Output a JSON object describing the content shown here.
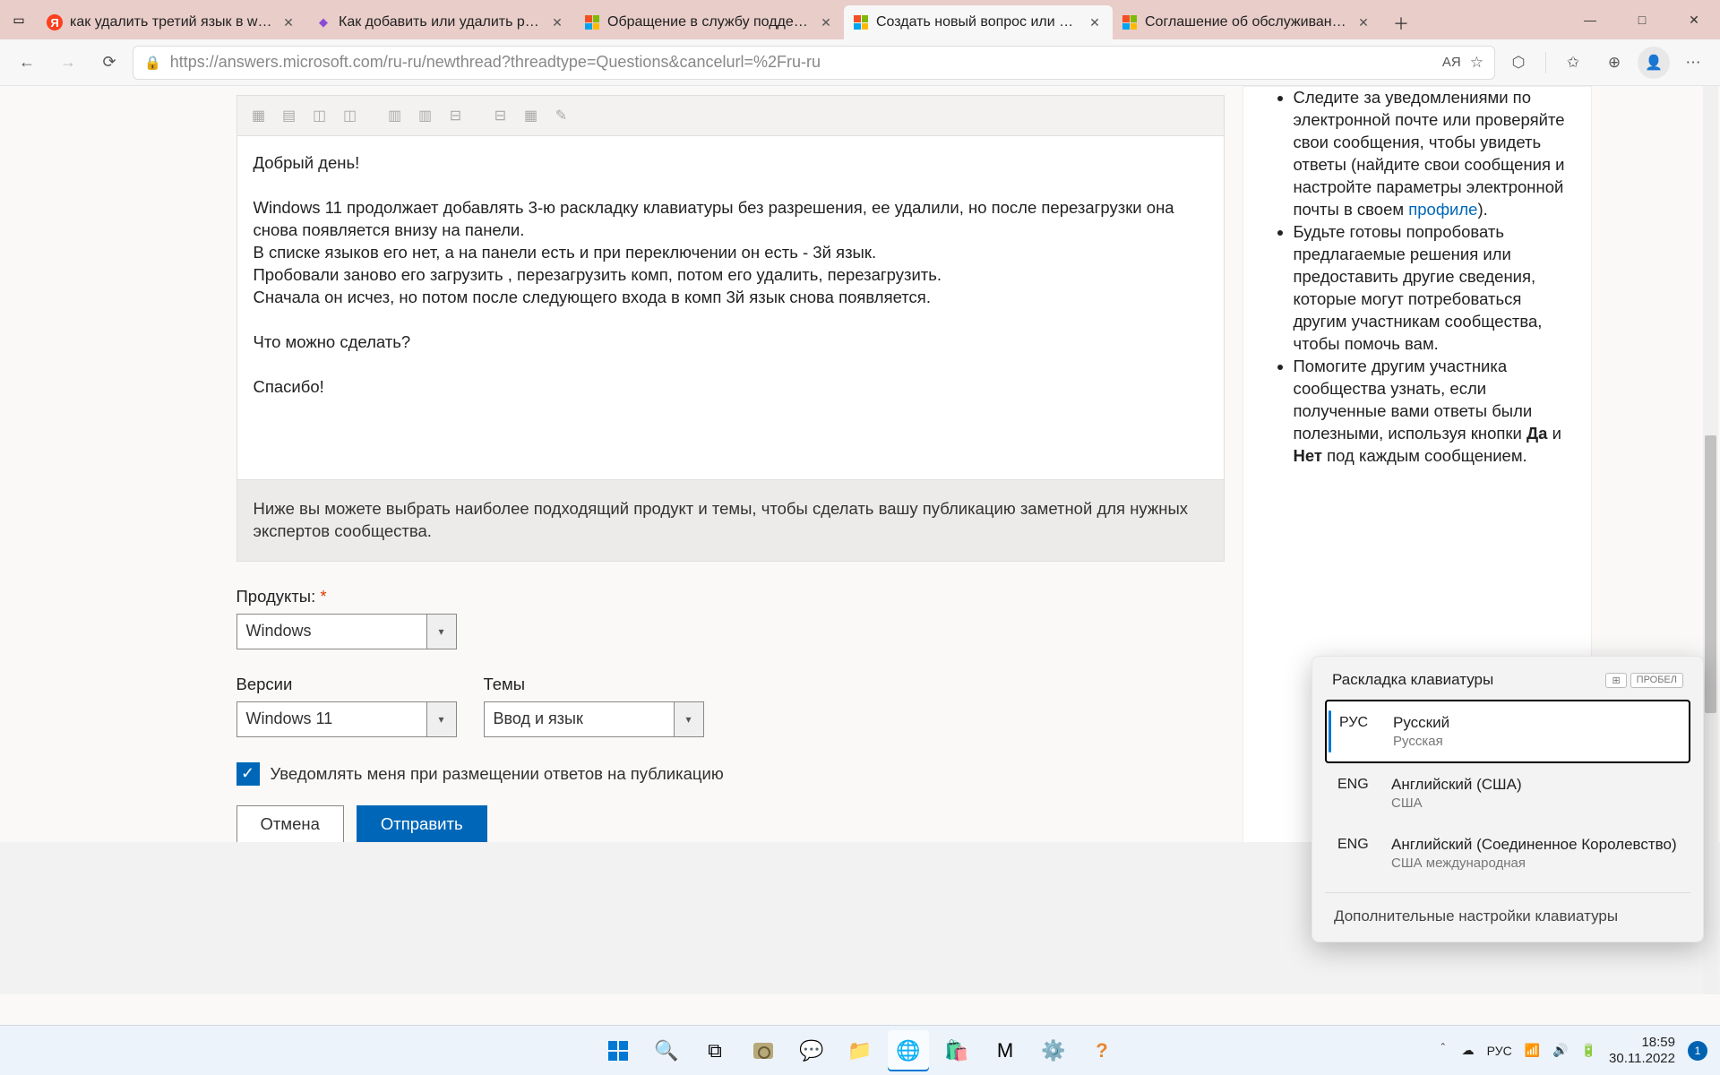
{
  "browser": {
    "tabs": [
      {
        "favicon": "yandex",
        "title": "как удалить третий язык в wind"
      },
      {
        "favicon": "purple",
        "title": "Как добавить или удалить раск"
      },
      {
        "favicon": "ms",
        "title": "Обращение в службу поддержк"
      },
      {
        "favicon": "ms",
        "title": "Создать новый вопрос или нач",
        "active": true
      },
      {
        "favicon": "ms",
        "title": "Соглашение об обслуживании"
      }
    ],
    "url": "https://answers.microsoft.com/ru-ru/newthread?threadtype=Questions&cancelurl=%2Fru-ru",
    "reader_mode": "AЯ"
  },
  "editor": {
    "lines": [
      "Добрый день!",
      "",
      "Windows 11 продолжает добавлять 3-ю раскладку клавиатуры без разрешения, ее удалили, но после перезагрузки она снова появляется внизу на панели.",
      "В списке языков его нет, а на панели есть и при переключении он есть - 3й язык.",
      "Пробовали заново его загрузить , перезагрузить комп, потом его удалить, перезагрузить.",
      "Сначала он исчез, но потом после следующего входа в комп 3й язык снова появляется.",
      "",
      "Что можно сделать?",
      "",
      "Спасибо!"
    ]
  },
  "info_strip": "Ниже вы можете выбрать наиболее подходящий продукт и темы, чтобы сделать вашу публикацию заметной для нужных экспертов сообщества.",
  "form": {
    "products_label": "Продукты:",
    "products_value": "Windows",
    "versions_label": "Версии",
    "versions_value": "Windows 11",
    "topics_label": "Темы",
    "topics_value": "Ввод и язык",
    "notify_label": "Уведомлять меня при размещении ответов на публикацию",
    "cancel": "Отмена",
    "submit": "Отправить"
  },
  "sidebar": {
    "item1_pre": "Следите за уведомлениями по электронной почте или проверяйте свои сообщения, чтобы увидеть ответы (найдите свои сообщения и настройте параметры электронной почты в своем ",
    "item1_link": "профиле",
    "item1_post": ").",
    "item2": "Будьте готовы попробовать предлагаемые решения или предоставить другие сведения, которые могут потребоваться другим участникам сообщества, чтобы помочь вам.",
    "item3_pre": "Помогите другим участника сообщества узнать, если полученные вами ответы были полезными, используя кнопки ",
    "item3_b1": "Да",
    "item3_mid": " и ",
    "item3_b2": "Нет",
    "item3_post": " под каждым сообщением."
  },
  "lang_switcher": {
    "title": "Раскладка клавиатуры",
    "key_hint": "ПРОБЕЛ",
    "items": [
      {
        "code": "РУС",
        "name": "Русский",
        "sub": "Русская",
        "selected": true
      },
      {
        "code": "ENG",
        "name": "Английский (США)",
        "sub": "США"
      },
      {
        "code": "ENG",
        "name": "Английский (Соединенное Королевство)",
        "sub": "США международная"
      }
    ],
    "footer": "Дополнительные настройки клавиатуры"
  },
  "tray": {
    "lang": "РУС",
    "time": "18:59",
    "date": "30.11.2022",
    "notif_count": "1"
  }
}
